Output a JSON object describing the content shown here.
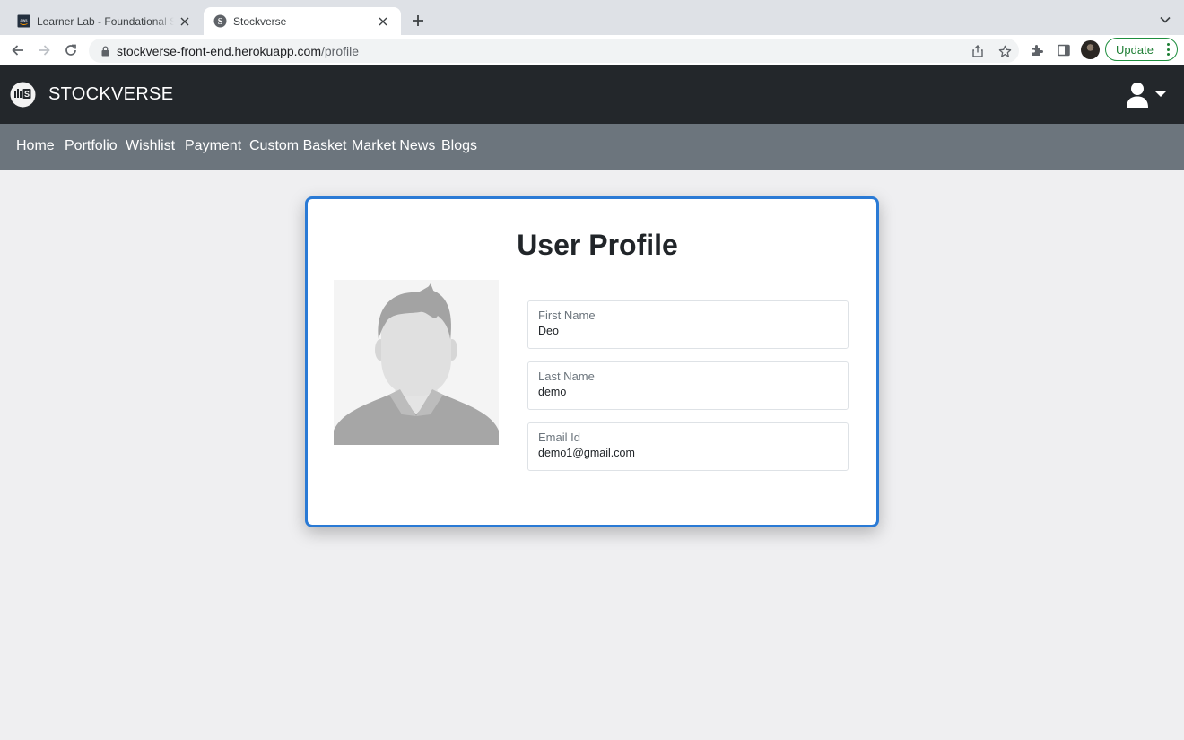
{
  "browser": {
    "tabs": [
      {
        "title": "Learner Lab - Foundational Services",
        "active": false,
        "favicon": "aws-icon"
      },
      {
        "title": "Stockverse",
        "active": true,
        "favicon": "stockverse-icon"
      }
    ],
    "url_host": "stockverse-front-end.herokuapp.com",
    "url_path": "/profile",
    "update_label": "Update"
  },
  "header": {
    "brand": "STOCKVERSE"
  },
  "nav": {
    "items": [
      {
        "label": "Home"
      },
      {
        "label": "Portfolio"
      },
      {
        "label": "Wishlist"
      },
      {
        "label": "Payment"
      },
      {
        "label": "Custom Basket"
      },
      {
        "label": "Market News"
      },
      {
        "label": "Blogs"
      }
    ]
  },
  "profile": {
    "title": "User Profile",
    "fields": [
      {
        "label": "First Name",
        "value": "Deo"
      },
      {
        "label": "Last Name",
        "value": "demo"
      },
      {
        "label": "Email Id",
        "value": "demo1@gmail.com"
      }
    ]
  },
  "colors": {
    "header_bg": "#23272b",
    "nav_bg": "#6c757d",
    "card_border": "#2a7ad5",
    "page_bg": "#efeff1"
  }
}
